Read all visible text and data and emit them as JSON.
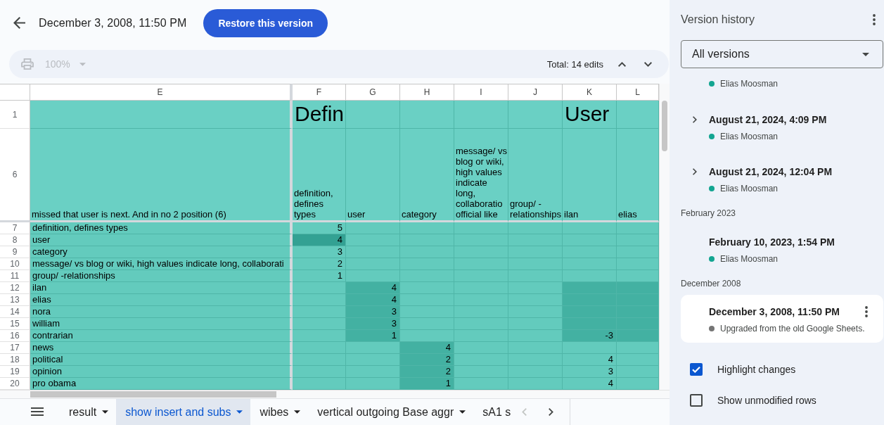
{
  "header": {
    "title": "December 3, 2008, 11:50 PM",
    "restore_button": "Restore this version"
  },
  "toolbar": {
    "print": {
      "disabled": true
    },
    "zoom": {
      "value": "100%",
      "disabled": true
    },
    "total_edits": "Total: 14 edits"
  },
  "sheet": {
    "columns": [
      "E",
      "F",
      "G",
      "H",
      "I",
      "J",
      "K",
      "L"
    ],
    "rows": [
      {
        "number": "1",
        "kind": "title",
        "cells": [
          {
            "changed": false,
            "strong": false
          },
          {
            "text": "Defin",
            "changed": false,
            "strong": false
          },
          {
            "changed": false,
            "strong": false
          },
          {
            "changed": false,
            "strong": false
          },
          {
            "changed": false,
            "strong": false
          },
          {
            "changed": false,
            "strong": false
          },
          {
            "text": "User",
            "changed": false,
            "strong": false
          },
          {
            "changed": false,
            "strong": false
          }
        ]
      },
      {
        "number": "6",
        "kind": "header",
        "cells": [
          {
            "text": "missed that user is next. And in no 2 position (6)",
            "changed": false,
            "strong": false
          },
          {
            "text": "definition, defines types",
            "changed": false,
            "strong": false
          },
          {
            "text": "user",
            "changed": false,
            "strong": false
          },
          {
            "text": "category",
            "changed": false,
            "strong": false
          },
          {
            "text": "message/ vs blog or wiki, high values indicate long, collaboratio official like",
            "changed": false,
            "strong": false
          },
          {
            "text": "group/ -relationships",
            "changed": false,
            "strong": false
          },
          {
            "text": "ilan",
            "changed": false,
            "strong": false
          },
          {
            "text": "elias",
            "changed": false,
            "strong": false
          }
        ]
      },
      {
        "number": "7",
        "kind": "data",
        "cells": [
          {
            "text": "definition, defines types",
            "changed": false,
            "strong": false
          },
          {
            "text": "5",
            "changed": false,
            "strong": false
          },
          {
            "changed": false,
            "strong": false
          },
          {
            "changed": false,
            "strong": false
          },
          {
            "changed": false,
            "strong": false
          },
          {
            "changed": false,
            "strong": false
          },
          {
            "changed": false,
            "strong": false
          },
          {
            "changed": false,
            "strong": false
          }
        ]
      },
      {
        "number": "8",
        "kind": "data",
        "cells": [
          {
            "text": "user",
            "changed": false,
            "strong": false
          },
          {
            "text": "4",
            "changed": false,
            "strong": true
          },
          {
            "changed": false,
            "strong": false
          },
          {
            "changed": false,
            "strong": false
          },
          {
            "changed": false,
            "strong": false
          },
          {
            "changed": false,
            "strong": false
          },
          {
            "changed": false,
            "strong": false
          },
          {
            "changed": false,
            "strong": false
          }
        ]
      },
      {
        "number": "9",
        "kind": "data",
        "cells": [
          {
            "text": "category",
            "changed": false,
            "strong": false
          },
          {
            "text": "3",
            "changed": false,
            "strong": false
          },
          {
            "changed": false,
            "strong": false
          },
          {
            "changed": false,
            "strong": false
          },
          {
            "changed": false,
            "strong": false
          },
          {
            "changed": false,
            "strong": false
          },
          {
            "changed": false,
            "strong": false
          },
          {
            "changed": false,
            "strong": false
          }
        ]
      },
      {
        "number": "10",
        "kind": "data",
        "cells": [
          {
            "text": "message/ vs blog or wiki, high values indicate long, collaborati",
            "changed": false,
            "strong": false
          },
          {
            "text": "2",
            "changed": false,
            "strong": false
          },
          {
            "changed": false,
            "strong": false
          },
          {
            "changed": false,
            "strong": false
          },
          {
            "changed": false,
            "strong": false
          },
          {
            "changed": false,
            "strong": false
          },
          {
            "changed": false,
            "strong": false
          },
          {
            "changed": false,
            "strong": false
          }
        ]
      },
      {
        "number": "11",
        "kind": "data",
        "cells": [
          {
            "text": "group/ -relationships",
            "changed": false,
            "strong": false
          },
          {
            "text": "1",
            "changed": false,
            "strong": false
          },
          {
            "changed": false,
            "strong": false
          },
          {
            "changed": false,
            "strong": false
          },
          {
            "changed": false,
            "strong": false
          },
          {
            "changed": false,
            "strong": false
          },
          {
            "changed": false,
            "strong": false
          },
          {
            "changed": false,
            "strong": false
          }
        ]
      },
      {
        "number": "12",
        "kind": "data",
        "cells": [
          {
            "text": "ilan",
            "changed": false,
            "strong": false
          },
          {
            "changed": false,
            "strong": false
          },
          {
            "text": "4",
            "changed": true,
            "strong": false
          },
          {
            "changed": false,
            "strong": false
          },
          {
            "changed": false,
            "strong": false
          },
          {
            "changed": false,
            "strong": false
          },
          {
            "changed": true,
            "strong": false
          },
          {
            "changed": true,
            "strong": false
          }
        ]
      },
      {
        "number": "13",
        "kind": "data",
        "cells": [
          {
            "text": "elias",
            "changed": false,
            "strong": false
          },
          {
            "changed": false,
            "strong": false
          },
          {
            "text": "4",
            "changed": true,
            "strong": false
          },
          {
            "changed": false,
            "strong": false
          },
          {
            "changed": false,
            "strong": false
          },
          {
            "changed": false,
            "strong": false
          },
          {
            "changed": true,
            "strong": false
          },
          {
            "changed": true,
            "strong": false
          }
        ]
      },
      {
        "number": "14",
        "kind": "data",
        "cells": [
          {
            "text": "nora",
            "changed": false,
            "strong": false
          },
          {
            "changed": false,
            "strong": false
          },
          {
            "text": "3",
            "changed": true,
            "strong": false
          },
          {
            "changed": false,
            "strong": false
          },
          {
            "changed": false,
            "strong": false
          },
          {
            "changed": false,
            "strong": false
          },
          {
            "changed": true,
            "strong": false
          },
          {
            "changed": true,
            "strong": false
          }
        ]
      },
      {
        "number": "15",
        "kind": "data",
        "cells": [
          {
            "text": "william",
            "changed": false,
            "strong": false
          },
          {
            "changed": false,
            "strong": false
          },
          {
            "text": "3",
            "changed": true,
            "strong": false
          },
          {
            "changed": false,
            "strong": false
          },
          {
            "changed": false,
            "strong": false
          },
          {
            "changed": false,
            "strong": false
          },
          {
            "changed": true,
            "strong": false
          },
          {
            "changed": true,
            "strong": false
          }
        ]
      },
      {
        "number": "16",
        "kind": "data",
        "cells": [
          {
            "text": "contrarian",
            "changed": false,
            "strong": false
          },
          {
            "changed": false,
            "strong": false
          },
          {
            "text": "1",
            "changed": true,
            "strong": false
          },
          {
            "changed": false,
            "strong": false
          },
          {
            "changed": false,
            "strong": false
          },
          {
            "changed": false,
            "strong": false
          },
          {
            "text": "-3",
            "changed": true,
            "strong": false
          },
          {
            "changed": true,
            "strong": false
          }
        ]
      },
      {
        "number": "17",
        "kind": "data",
        "cells": [
          {
            "text": "news",
            "changed": false,
            "strong": false
          },
          {
            "changed": false,
            "strong": false
          },
          {
            "changed": false,
            "strong": false
          },
          {
            "text": "4",
            "changed": true,
            "strong": false
          },
          {
            "changed": false,
            "strong": false
          },
          {
            "changed": false,
            "strong": false
          },
          {
            "changed": false,
            "strong": false
          },
          {
            "changed": false,
            "strong": false
          }
        ]
      },
      {
        "number": "18",
        "kind": "data",
        "cells": [
          {
            "text": "political",
            "changed": false,
            "strong": false
          },
          {
            "changed": false,
            "strong": false
          },
          {
            "changed": false,
            "strong": false
          },
          {
            "text": "2",
            "changed": true,
            "strong": false
          },
          {
            "changed": false,
            "strong": false
          },
          {
            "changed": false,
            "strong": false
          },
          {
            "text": "4",
            "changed": false,
            "strong": false
          },
          {
            "changed": false,
            "strong": false
          }
        ]
      },
      {
        "number": "19",
        "kind": "data",
        "cells": [
          {
            "text": "opinion",
            "changed": false,
            "strong": false
          },
          {
            "changed": false,
            "strong": false
          },
          {
            "changed": false,
            "strong": false
          },
          {
            "text": "2",
            "changed": true,
            "strong": false
          },
          {
            "changed": false,
            "strong": false
          },
          {
            "changed": false,
            "strong": false
          },
          {
            "text": "3",
            "changed": false,
            "strong": false
          },
          {
            "changed": false,
            "strong": false
          }
        ]
      },
      {
        "number": "20",
        "kind": "data",
        "cells": [
          {
            "text": "pro obama",
            "changed": false,
            "strong": false
          },
          {
            "changed": false,
            "strong": false
          },
          {
            "changed": false,
            "strong": false
          },
          {
            "text": "1",
            "changed": true,
            "strong": false
          },
          {
            "changed": false,
            "strong": false
          },
          {
            "changed": false,
            "strong": false
          },
          {
            "text": "4",
            "changed": false,
            "strong": false
          },
          {
            "changed": false,
            "strong": false
          }
        ]
      }
    ]
  },
  "sheet_tabs": {
    "tabs": [
      {
        "label": "result",
        "selected": false,
        "dropdown": true
      },
      {
        "label": "show insert and subs",
        "selected": true,
        "dropdown": true
      },
      {
        "label": "wibes",
        "selected": false,
        "dropdown": true
      },
      {
        "label": "vertical outgoing Base aggr",
        "selected": false,
        "dropdown": true
      },
      {
        "label": "sA1 s",
        "selected": false,
        "dropdown": false
      }
    ],
    "scroll_buttons": [
      {
        "disabled": true
      },
      {
        "disabled": false
      }
    ]
  },
  "version_history": {
    "title": "Version history",
    "filter": "All versions",
    "entries": [
      {
        "kind": "version",
        "subtitle": "Elias Moosman",
        "color": "#13a591",
        "selected": false
      },
      {
        "kind": "version",
        "date": "August 21, 2024, 4:09 PM",
        "subtitle": "Elias Moosman",
        "color": "#13a591",
        "expandable": true,
        "expanded": false,
        "selected": false
      },
      {
        "kind": "version",
        "date": "August 21, 2024, 12:04 PM",
        "subtitle": "Elias Moosman",
        "color": "#13a591",
        "expandable": true,
        "expanded": false,
        "selected": false
      },
      {
        "kind": "month",
        "label": "February 2023"
      },
      {
        "kind": "version",
        "date": "February 10, 2023, 1:54 PM",
        "subtitle": "Elias Moosman",
        "color": "#13a591",
        "expandable": false,
        "selected": false
      },
      {
        "kind": "month",
        "label": "December 2008"
      },
      {
        "kind": "version",
        "date": "December 3, 2008, 11:50 PM",
        "subtitle": "Upgraded from the old Google Sheets.",
        "color": "#757575",
        "expandable": false,
        "selected": true
      }
    ],
    "options": [
      {
        "label": "Highlight changes",
        "checked": true
      },
      {
        "label": "Show unmodified rows",
        "checked": false
      }
    ]
  }
}
